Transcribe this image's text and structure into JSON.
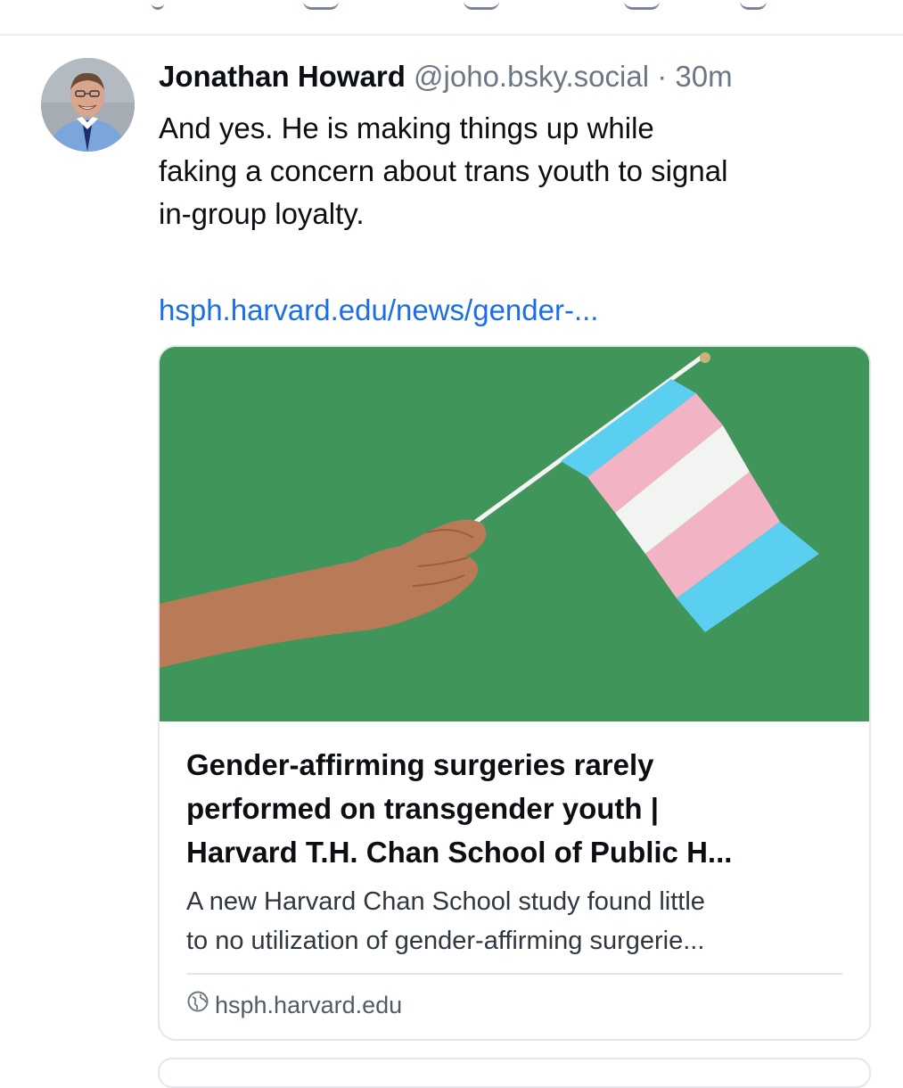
{
  "post": {
    "author_name": "Jonathan Howard",
    "handle": "@joho.bsky.social",
    "separator": "·",
    "timestamp": "30m",
    "text_lines": [
      "And yes.  He is making things up while",
      "faking a concern about trans youth to signal",
      "in-group loyalty."
    ],
    "link_text": "hsph.harvard.edu/news/gender-..."
  },
  "link_card": {
    "image_icon": "trans-flag-photo",
    "title_lines": [
      "Gender-affirming surgeries rarely",
      "performed on transgender youth |",
      "Harvard T.H. Chan School of Public H..."
    ],
    "description_lines": [
      "A new Harvard Chan School study found little",
      "to no utilization of gender-affirming surgerie..."
    ],
    "domain_icon": "globe-icon",
    "domain": "hsph.harvard.edu"
  },
  "colors": {
    "link": "#1a6ee8",
    "muted": "#6b7785",
    "image_background": "#3f955a",
    "flag_blue": "#5bcff0",
    "flag_pink": "#f2b3c4",
    "flag_white": "#f2f4f2"
  }
}
